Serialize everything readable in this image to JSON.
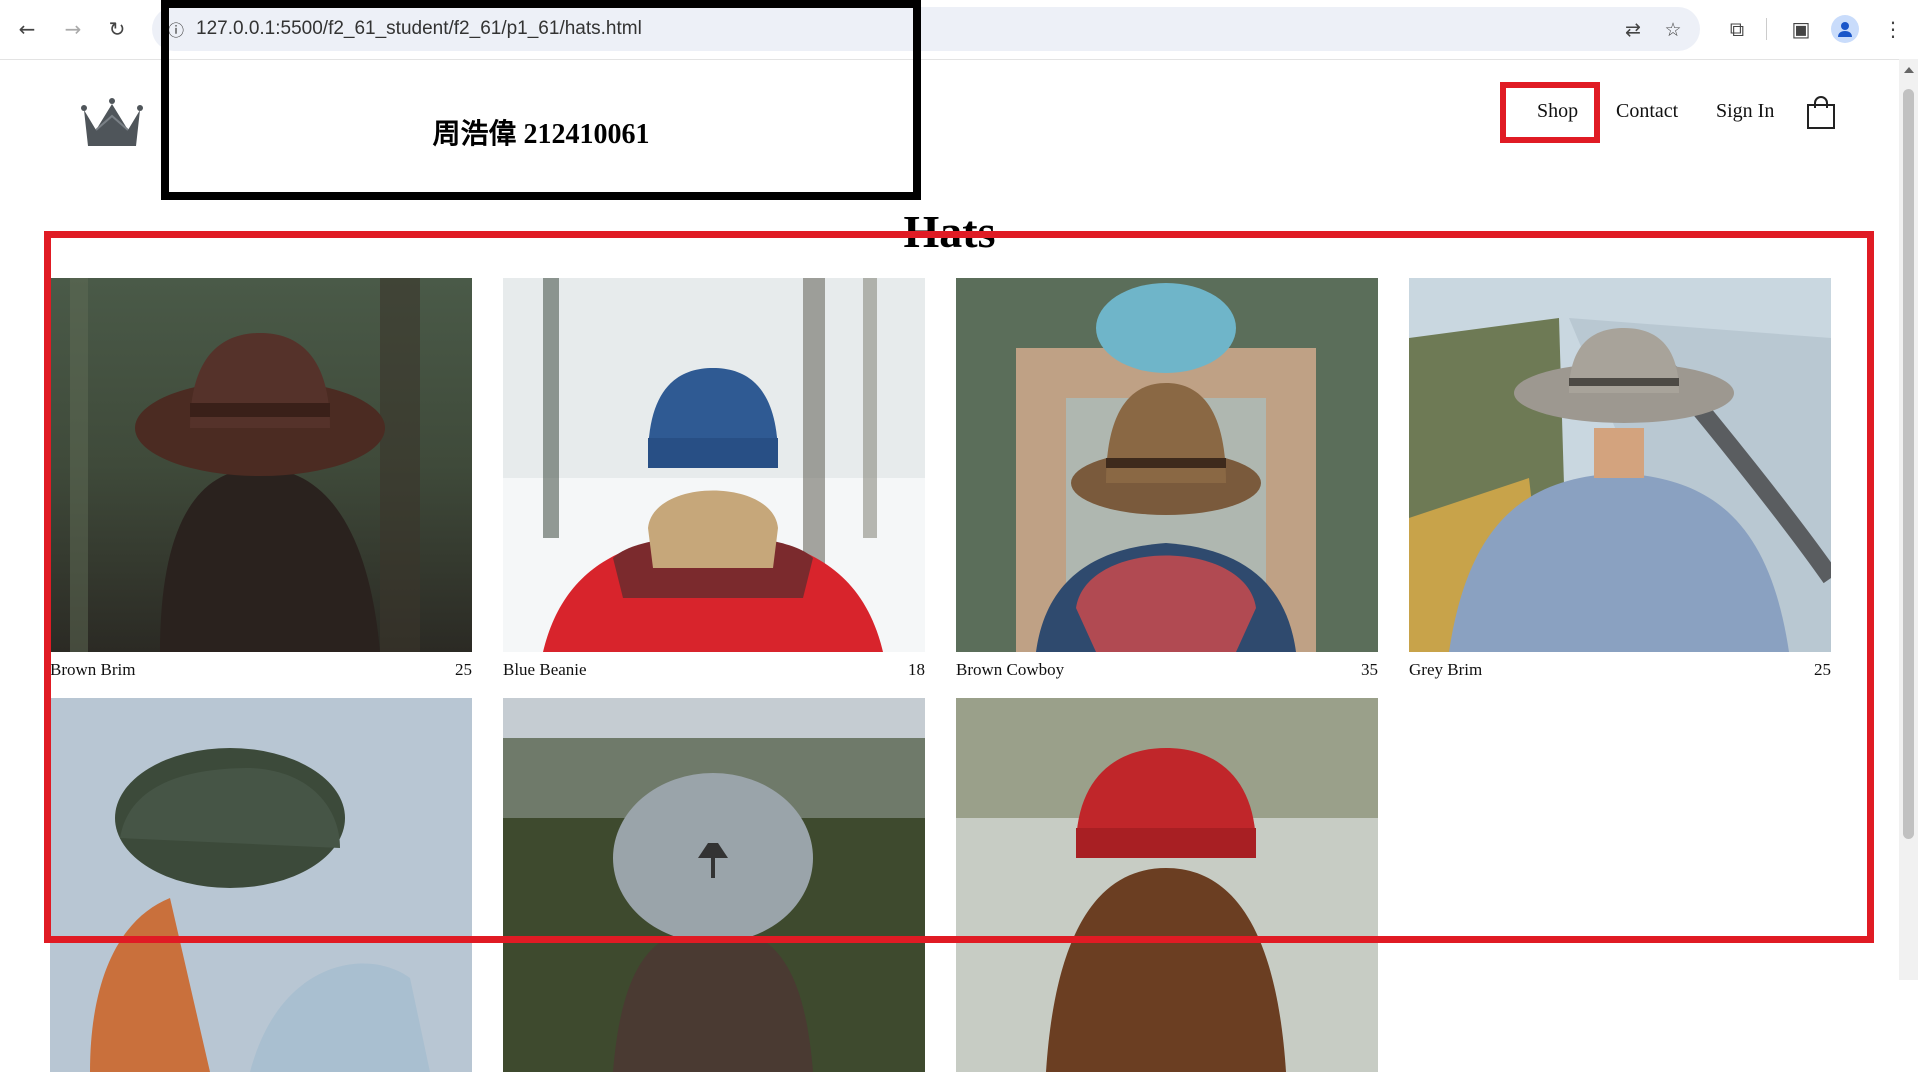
{
  "browser": {
    "url": "127.0.0.1:5500/f2_61_student/f2_61/p1_61/hats.html",
    "back_icon": "arrow-left-icon",
    "forward_icon": "arrow-right-icon",
    "reload_icon": "reload-icon"
  },
  "header": {
    "student_label": "周浩偉 212410061",
    "nav": [
      {
        "label": "Shop"
      },
      {
        "label": "Contact"
      },
      {
        "label": "Sign In"
      }
    ],
    "bag_icon": "shopping-bag-icon",
    "logo_icon": "crown-icon"
  },
  "main": {
    "title": "Hats",
    "products": [
      {
        "name": "Brown Brim",
        "price": "25"
      },
      {
        "name": "Blue Beanie",
        "price": "18"
      },
      {
        "name": "Brown Cowboy",
        "price": "35"
      },
      {
        "name": "Grey Brim",
        "price": "25"
      },
      {
        "name": "",
        "price": ""
      },
      {
        "name": "",
        "price": ""
      },
      {
        "name": "",
        "price": ""
      }
    ]
  },
  "colors": {
    "highlight_red": "#e01b24",
    "box_black": "#000000"
  }
}
